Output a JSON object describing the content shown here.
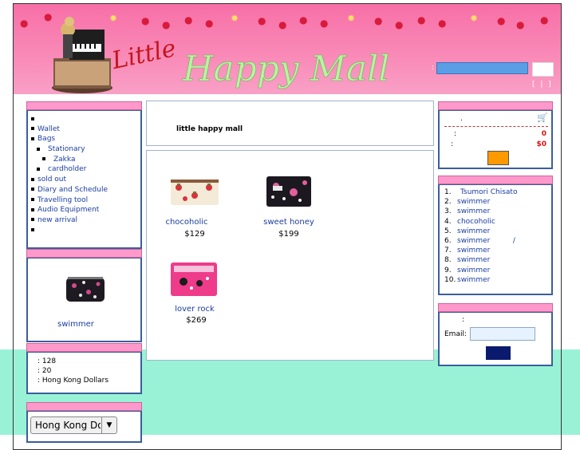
{
  "header": {
    "logo_text": "Little Happy Mall",
    "search_label": ":",
    "links_text": "[ | ]"
  },
  "categories": {
    "items": [
      {
        "label": "",
        "indent": 0
      },
      {
        "label": "Wallet",
        "indent": 0
      },
      {
        "label": "Bags",
        "indent": 0
      },
      {
        "label": "Stationary",
        "indent": 1
      },
      {
        "label": "Zakka",
        "indent": 2
      },
      {
        "label": "cardholder",
        "indent": 1
      },
      {
        "label": "sold out",
        "indent": 0
      },
      {
        "label": "Diary and Schedule",
        "indent": 0
      },
      {
        "label": "Travelling tool",
        "indent": 0
      },
      {
        "label": "Audio Equipment",
        "indent": 0
      },
      {
        "label": "new arrival",
        "indent": 0
      },
      {
        "label": "",
        "indent": 0
      }
    ]
  },
  "featured": {
    "name": "swimmer"
  },
  "stats": {
    "line1": ": 128",
    "line2": ": 20",
    "line3": ": Hong Kong Dollars"
  },
  "currency": {
    "selected": "Hong Kong Dollars"
  },
  "center": {
    "title": "little happy mall",
    "products": [
      {
        "name": "chocoholic",
        "price": "$129"
      },
      {
        "name": "sweet honey",
        "price": "$199"
      },
      {
        "name": "lover rock",
        "price": "$269"
      }
    ]
  },
  "cart": {
    "dot": ".",
    "items_label": ":",
    "items_value": "0",
    "total_label": ":",
    "total_value": "$0"
  },
  "ranking": {
    "items": [
      {
        "n": "1.",
        "title": "Tsumori Chisato"
      },
      {
        "n": "2.",
        "title": "swimmer"
      },
      {
        "n": "3.",
        "title": "swimmer"
      },
      {
        "n": "4.",
        "title": "chocoholic"
      },
      {
        "n": "5.",
        "title": "swimmer"
      },
      {
        "n": "6.",
        "title": "swimmer          /"
      },
      {
        "n": "7.",
        "title": "swimmer"
      },
      {
        "n": "8.",
        "title": "swimmer"
      },
      {
        "n": "9.",
        "title": "swimmer"
      },
      {
        "n": "10.",
        "title": "swimmer"
      }
    ]
  },
  "newsletter": {
    "colon": ":",
    "email_label": "Email:"
  },
  "colors": {
    "header_pink": "#f76fa7",
    "bar_pink": "#ff99cc",
    "border_blue": "#3a5e9c",
    "mint": "#99f2d6",
    "link_blue": "#1a3da0",
    "cart_button": "#ff9900",
    "newsletter_button": "#0a1a6e"
  }
}
